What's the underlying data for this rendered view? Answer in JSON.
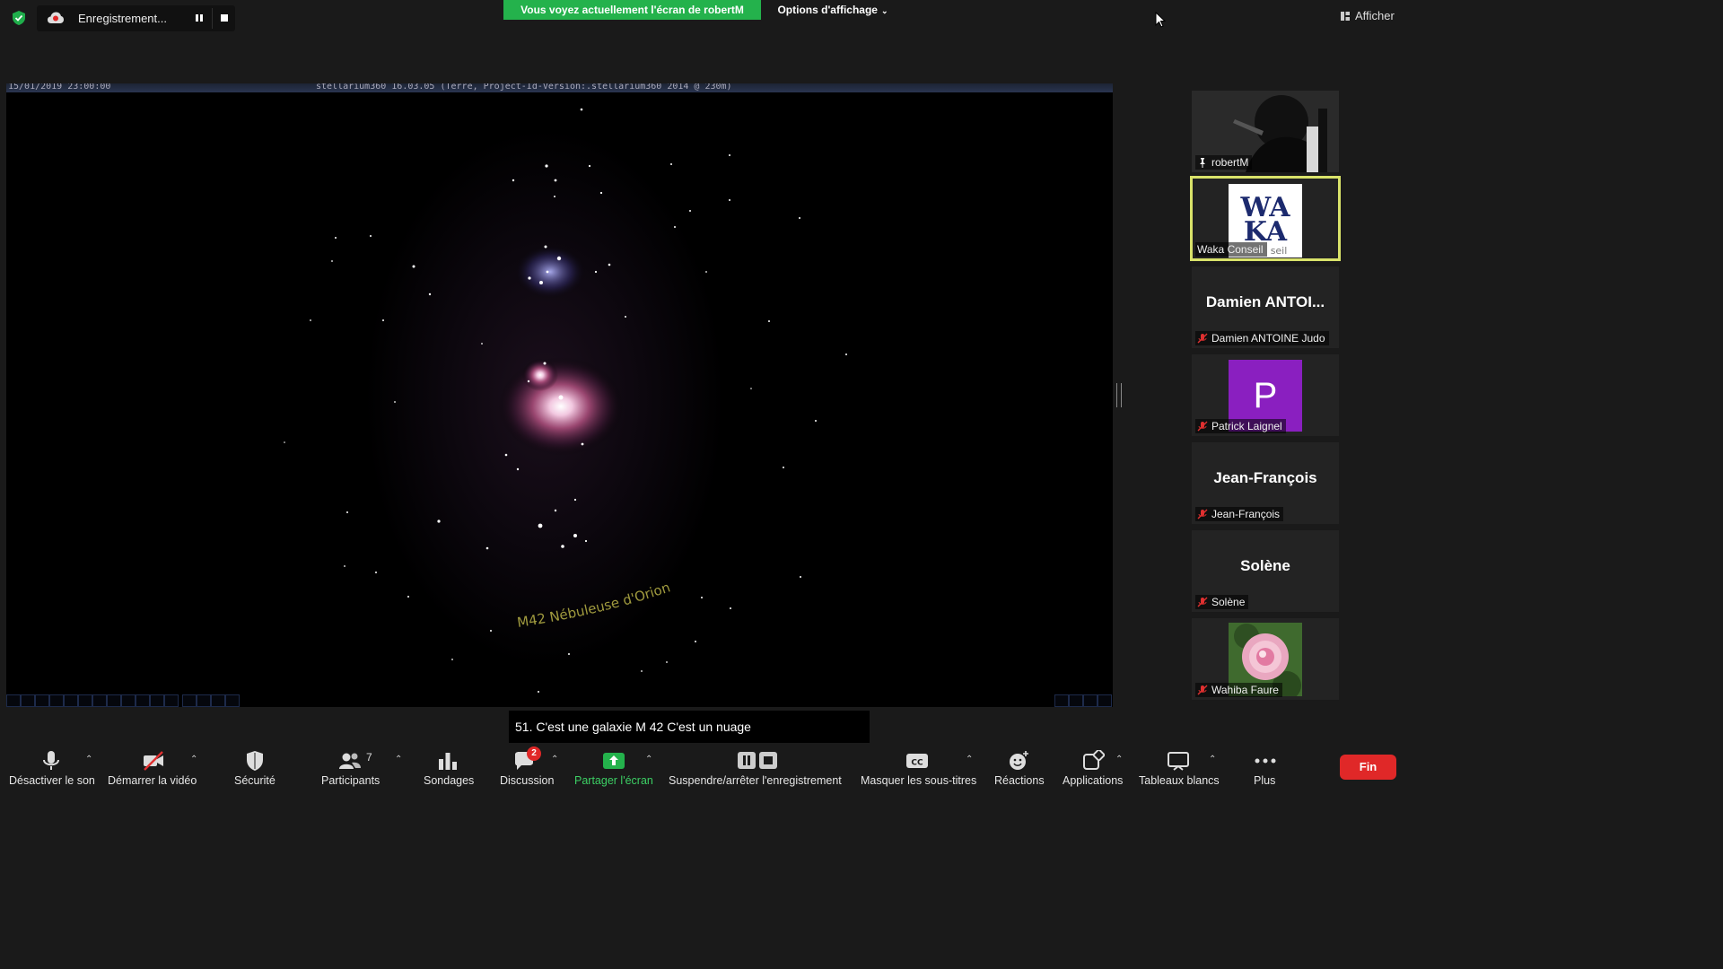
{
  "topbar": {
    "recording_label": "Enregistrement...",
    "share_banner": "Vous voyez actuellement l'écran de robertM",
    "view_options": "Options d'affichage",
    "show_label": "Afficher"
  },
  "shared_screen": {
    "datetime": "15/01/2019 23:00:00",
    "app_info": "stellarium360 16.03.05 (Terre, Project-Id-Version:.stellarium360 2014 @ 230m)",
    "object_label": "M42 Nébuleuse d'Orion"
  },
  "participants": [
    {
      "name": "robertM",
      "big_name": "",
      "avatar": "video",
      "avatar_letter": "",
      "pinned": true,
      "muted": false
    },
    {
      "name": "Waka Conseil",
      "big_name": "",
      "avatar": "logo",
      "avatar_letter": "",
      "pinned": false,
      "muted": false,
      "logo_top": "WA",
      "logo_bottom": "KA",
      "logo_sub": "seil"
    },
    {
      "name": "Damien ANTOINE Judo",
      "big_name": "Damien  ANTOI...",
      "avatar": "none",
      "avatar_letter": "",
      "pinned": false,
      "muted": true
    },
    {
      "name": "Patrick Laignel",
      "big_name": "",
      "avatar": "letter",
      "avatar_letter": "P",
      "pinned": false,
      "muted": true
    },
    {
      "name": "Jean-François",
      "big_name": "Jean-François",
      "avatar": "none",
      "avatar_letter": "",
      "pinned": false,
      "muted": true
    },
    {
      "name": "Solène",
      "big_name": "Solène",
      "avatar": "none",
      "avatar_letter": "",
      "pinned": false,
      "muted": true
    },
    {
      "name": "Wahiba Faure",
      "big_name": "",
      "avatar": "photo",
      "avatar_letter": "",
      "pinned": false,
      "muted": true
    }
  ],
  "subtitle": "51. C'est une galaxie M 42 C'est un nuage",
  "toolbar": {
    "mute": "Désactiver le son",
    "video": "Démarrer la vidéo",
    "security": "Sécurité",
    "participants": "Participants",
    "participants_count": "7",
    "polls": "Sondages",
    "chat": "Discussion",
    "chat_badge": "2",
    "share": "Partager l'écran",
    "record": "Suspendre/arrêter l'enregistrement",
    "captions": "Masquer les sous-titres",
    "reactions": "Réactions",
    "apps": "Applications",
    "whiteboards": "Tableaux blancs",
    "more": "Plus",
    "end": "Fin"
  },
  "colors": {
    "share_green": "#24b24c",
    "end_red": "#e02828",
    "active_speaker": "#d9e36a",
    "avatar_purple": "#8a1fc0"
  }
}
